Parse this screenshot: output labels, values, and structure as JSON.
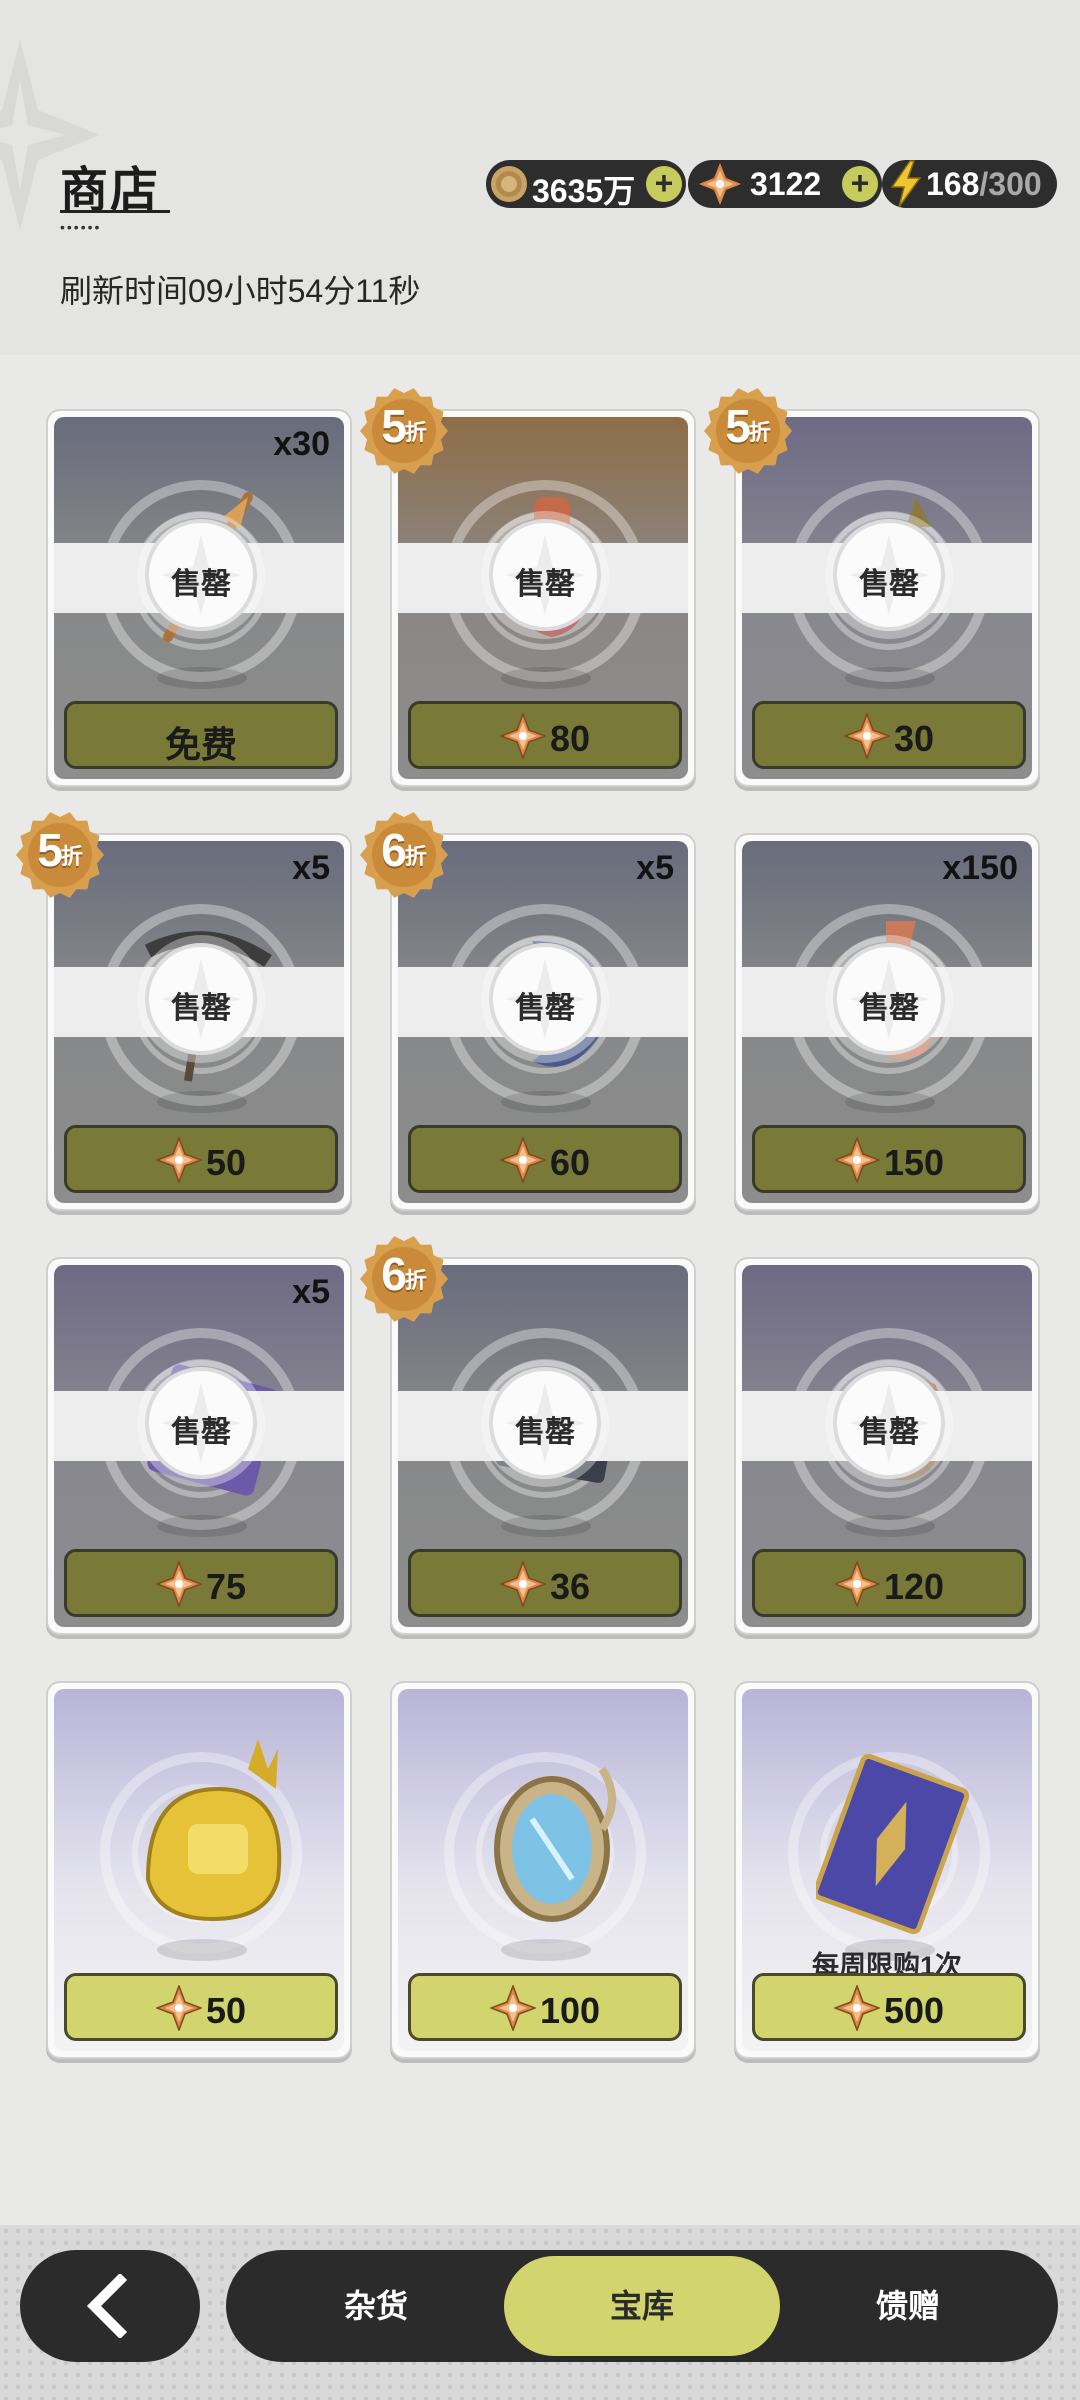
{
  "header": {
    "title": "商店",
    "refresh_text": "刷新时间09小时54分11秒",
    "currencies": {
      "gold": {
        "value": "3635万",
        "icon": "gold-coin-icon",
        "add_label": "+"
      },
      "gem": {
        "value": "3122",
        "icon": "orange-star-gem-icon",
        "add_label": "+"
      },
      "energy": {
        "current": "168",
        "max": "/300",
        "icon": "lightning-bolt-icon"
      }
    }
  },
  "sold_out_label": "售罄",
  "items": [
    {
      "quantity": "x30",
      "discount": "",
      "price": "免费",
      "price_icon": "",
      "sold_out": true,
      "item_icon": "quill-pen-icon",
      "note": ""
    },
    {
      "quantity": "",
      "discount": "5",
      "price": "80",
      "price_icon": "orange-star-gem-icon",
      "sold_out": true,
      "item_icon": "red-flask-icon",
      "note": ""
    },
    {
      "quantity": "",
      "discount": "5",
      "price": "30",
      "price_icon": "orange-star-gem-icon",
      "sold_out": true,
      "item_icon": "pink-charm-icon",
      "note": ""
    },
    {
      "quantity": "x5",
      "discount": "5",
      "price": "50",
      "price_icon": "orange-star-gem-icon",
      "sold_out": true,
      "item_icon": "pickaxe-icon",
      "note": ""
    },
    {
      "quantity": "x5",
      "discount": "6",
      "price": "60",
      "price_icon": "orange-star-gem-icon",
      "sold_out": true,
      "item_icon": "blue-crescent-icon",
      "note": ""
    },
    {
      "quantity": "x150",
      "discount": "",
      "price": "150",
      "price_icon": "orange-star-gem-icon",
      "sold_out": true,
      "item_icon": "orange-potion-icon",
      "note": ""
    },
    {
      "quantity": "x5",
      "discount": "",
      "price": "75",
      "price_icon": "orange-star-gem-icon",
      "sold_out": true,
      "item_icon": "purple-book-icon",
      "note": ""
    },
    {
      "quantity": "",
      "discount": "6",
      "price": "36",
      "price_icon": "orange-star-gem-icon",
      "sold_out": true,
      "item_icon": "dark-box-icon",
      "note": ""
    },
    {
      "quantity": "",
      "discount": "",
      "price": "120",
      "price_icon": "orange-star-gem-icon",
      "sold_out": true,
      "item_icon": "brown-pouch-icon",
      "note": ""
    },
    {
      "quantity": "",
      "discount": "",
      "price": "50",
      "price_icon": "orange-star-gem-icon",
      "sold_out": false,
      "item_icon": "golden-helmet-icon",
      "note": ""
    },
    {
      "quantity": "",
      "discount": "",
      "price": "100",
      "price_icon": "orange-star-gem-icon",
      "sold_out": false,
      "item_icon": "ornate-mirror-icon",
      "note": ""
    },
    {
      "quantity": "",
      "discount": "",
      "price": "500",
      "price_icon": "orange-star-gem-icon",
      "sold_out": false,
      "item_icon": "blue-card-icon",
      "note": "每周限购1次"
    }
  ],
  "discount_suffix": "折",
  "nav": {
    "back_icon": "chevron-left-icon",
    "tabs": [
      {
        "label": "杂货",
        "selected": false
      },
      {
        "label": "宝库",
        "selected": true
      },
      {
        "label": "馈赠",
        "selected": false
      }
    ]
  },
  "colors": {
    "accent": "#d2d46d",
    "sold_price_button": "#7a7a38",
    "nav_bg": "#2b2b2b"
  }
}
